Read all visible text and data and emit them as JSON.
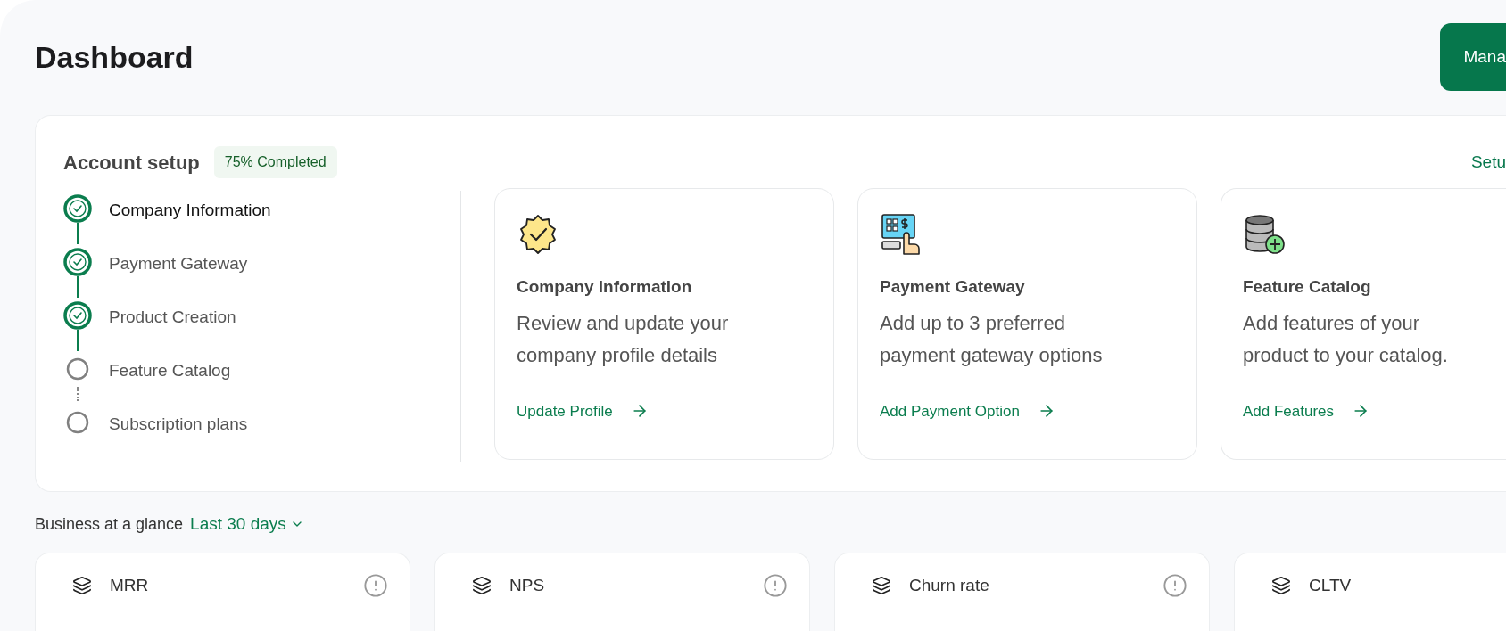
{
  "page_title": "Dashboard",
  "header_button": {
    "label": "Mana"
  },
  "account_setup": {
    "title": "Account setup",
    "badge": "75% Completed",
    "link": "Setu",
    "steps": [
      {
        "label": "Company Information",
        "completed": true,
        "selected": true
      },
      {
        "label": "Payment Gateway",
        "completed": true,
        "selected": false
      },
      {
        "label": "Product Creation",
        "completed": true,
        "selected": false
      },
      {
        "label": "Feature Catalog",
        "completed": false,
        "selected": false
      },
      {
        "label": "Subscription plans",
        "completed": false,
        "selected": false
      }
    ],
    "cards": [
      {
        "kind": "verified",
        "title": "Company Information",
        "description": "Review and update your company profile details",
        "action": "Update Profile"
      },
      {
        "kind": "payment",
        "title": "Payment Gateway",
        "description": "Add up to 3 preferred payment gateway options",
        "action": "Add Payment Option"
      },
      {
        "kind": "database",
        "title": "Feature Catalog",
        "description": "Add features of your product to your catalog.",
        "action": "Add Features"
      }
    ]
  },
  "business": {
    "label": "Business at a glance",
    "period": "Last 30 days",
    "metrics": [
      {
        "label": "MRR",
        "info_icon": true
      },
      {
        "label": "NPS",
        "info_icon": true
      },
      {
        "label": "Churn rate",
        "info_icon": true
      },
      {
        "label": "CLTV",
        "info_icon": false
      }
    ]
  }
}
